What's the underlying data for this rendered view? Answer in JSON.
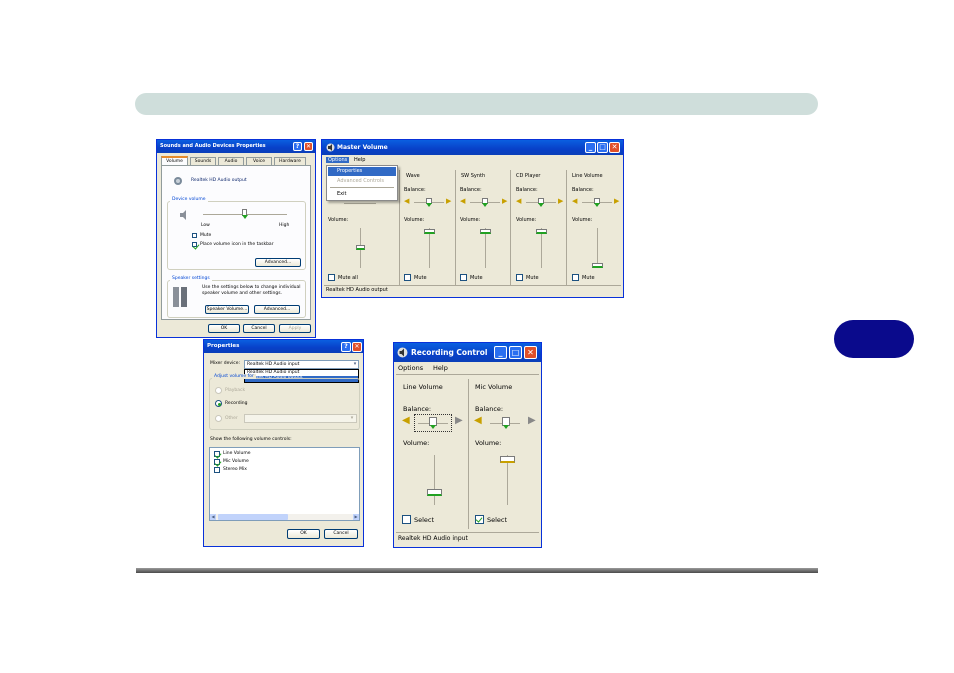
{
  "colors": {
    "header_bar": "#cfdedb",
    "tab_oval": "#0a0a8c",
    "xp_blue": "#0840c8",
    "xp_face": "#ece9d8",
    "check_green": "#21a121",
    "close_red": "#e0502a"
  },
  "sounds": {
    "title": "Sounds and Audio Devices Properties",
    "tabs": [
      "Volume",
      "Sounds",
      "Audio",
      "Voice",
      "Hardware"
    ],
    "device": "Realtek HD Audio output",
    "device_volume_group": "Device volume",
    "low": "Low",
    "high": "High",
    "mute": "Mute",
    "place_icon": "Place volume icon in the taskbar",
    "advanced": "Advanced...",
    "speaker_group": "Speaker settings",
    "speaker_text": [
      "Use the settings below to change individual",
      "speaker volume and other settings."
    ],
    "speaker_volume": "Speaker Volume...",
    "advanced2": "Advanced...",
    "ok": "OK",
    "cancel": "Cancel",
    "apply": "Apply"
  },
  "master": {
    "title": "Master Volume",
    "menu": [
      "Options",
      "Help"
    ],
    "dropdown": [
      "Properties",
      "Advanced Controls",
      "Exit"
    ],
    "columns": [
      "Wave",
      "SW Synth",
      "CD Player",
      "Line Volume"
    ],
    "balance": "Balance:",
    "volume": "Volume:",
    "mute_all": "Mute all",
    "mute": "Mute",
    "status": "Realtek HD Audio output"
  },
  "props": {
    "title": "Properties",
    "mixer_label": "Mixer device:",
    "mixer_value": "Realtek HD Audio input",
    "mixer_options": [
      "Realtek HD Audio input",
      "Realtek HD Audio output"
    ],
    "adjust": "Adjust volume for",
    "playback": "Playback",
    "recording": "Recording",
    "other": "Other",
    "show_label": "Show the following volume controls:",
    "controls": [
      "Line Volume",
      "Mic Volume",
      "Stereo Mix"
    ],
    "ok": "OK",
    "cancel": "Cancel"
  },
  "recording": {
    "title": "Recording Control",
    "menu": [
      "Options",
      "Help"
    ],
    "columns": [
      "Line Volume",
      "Mic Volume"
    ],
    "balance": "Balance:",
    "volume": "Volume:",
    "select": "Select",
    "status": "Realtek HD Audio input"
  }
}
